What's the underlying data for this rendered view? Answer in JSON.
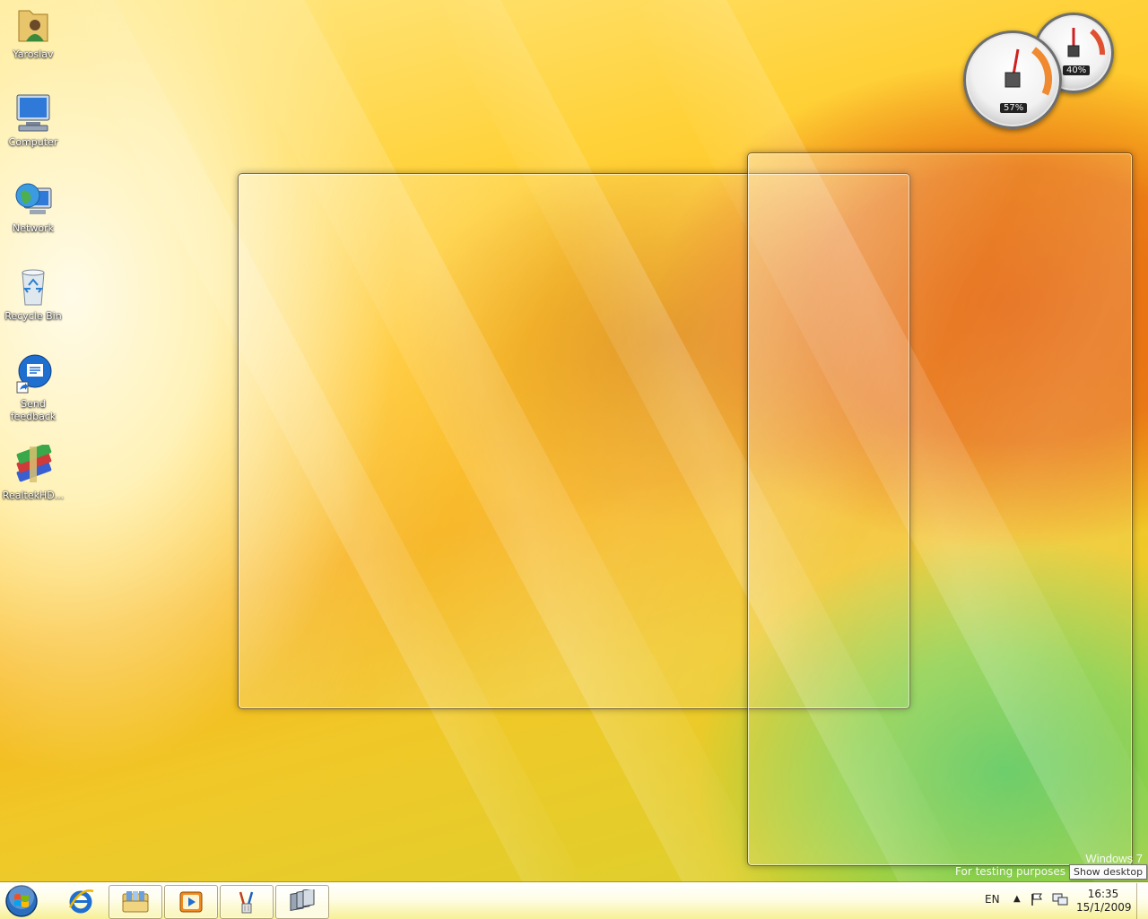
{
  "desktop_icons": [
    {
      "label": "Yaroslav",
      "icon": "user-folder-icon"
    },
    {
      "label": "Computer",
      "icon": "computer-icon"
    },
    {
      "label": "Network",
      "icon": "network-icon"
    },
    {
      "label": "Recycle Bin",
      "icon": "recycle-bin-icon"
    },
    {
      "label": "Send feedback",
      "icon": "send-feedback-icon"
    },
    {
      "label": "RealtekHD...",
      "icon": "winrar-archive-icon"
    }
  ],
  "gadgets": {
    "cpu_meter": {
      "cpu_percent": "57%",
      "memory_percent": "40%"
    }
  },
  "watermark": {
    "os_name": "Windows 7",
    "note": "For testing purposes"
  },
  "tooltip": {
    "show_desktop": "Show desktop"
  },
  "taskbar": {
    "pinned": [
      {
        "name": "internet-explorer",
        "icon": "internet-explorer-icon",
        "running": false
      },
      {
        "name": "windows-explorer",
        "icon": "folder-library-icon",
        "running": true
      },
      {
        "name": "media-player",
        "icon": "media-player-icon",
        "running": true
      },
      {
        "name": "paint",
        "icon": "paint-icon",
        "running": true
      },
      {
        "name": "flip3d-windows",
        "icon": "window-switcher-icon",
        "running": true,
        "active": true
      }
    ],
    "tray": {
      "language": "EN",
      "time": "16:35",
      "date": "15/1/2009"
    }
  },
  "colors": {
    "accent_orange": "#e56a12",
    "accent_yellow": "#ffd23a",
    "accent_green": "#5cc85a"
  }
}
